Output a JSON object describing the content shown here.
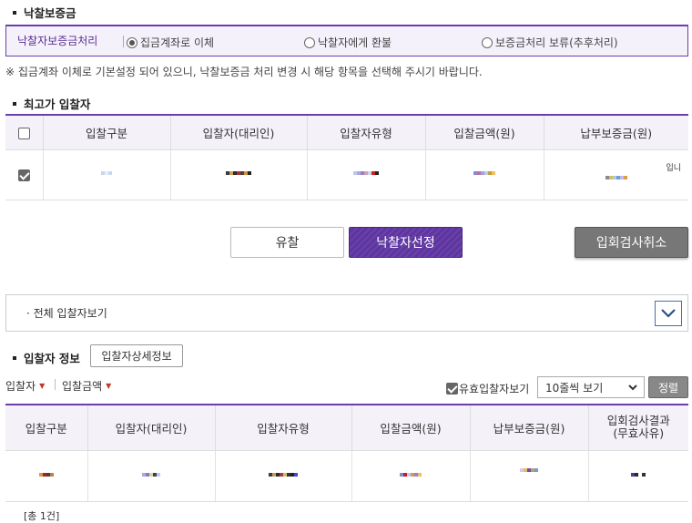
{
  "deposit": {
    "section_title": "낙찰보증금",
    "label": "낙찰자보증금처리",
    "options": [
      {
        "label": "집금계좌로 이체",
        "selected": true
      },
      {
        "label": "낙찰자에게 환불",
        "selected": false
      },
      {
        "label": "보증금처리 보류(추후처리)",
        "selected": false
      }
    ],
    "notice": "※ 집금계좌 이체로 기본설정 되어 있으니, 낙찰보증금 처리 변경 시 해당 항목을 선택해 주시기 바랍니다."
  },
  "top_bidder": {
    "section_title": "최고가 입찰자",
    "headers": [
      "입찰구분",
      "입찰자(대리인)",
      "입찰자유형",
      "입찰금액(원)",
      "납부보증금(원)"
    ],
    "row_checked": true,
    "cell_fragment": "입니"
  },
  "actions": {
    "fail_bid": "유찰",
    "select_winner": "낙찰자선정",
    "cancel_review": "입회검사취소"
  },
  "all_bidders": {
    "label": "전체 입찰자보기"
  },
  "bidder_info": {
    "section_title": "입찰자 정보",
    "detail_button": "입찰자상세정보",
    "sort_bidder": "입찰자",
    "sort_amount": "입찰금액",
    "valid_only_label": "유효입찰자보기",
    "valid_only_checked": true,
    "page_size_selected": "10줄씩 보기",
    "sort_button": "정렬",
    "headers": [
      "입찰구분",
      "입찰자(대리인)",
      "입찰자유형",
      "입찰금액(원)",
      "납부보증금(원)",
      "입회검사결과\n(무효사유)"
    ],
    "total": "[총 1건]"
  },
  "colors": {
    "accent": "#5e35a0",
    "header_bg": "#f4f1f9",
    "gray_button": "#777777"
  }
}
